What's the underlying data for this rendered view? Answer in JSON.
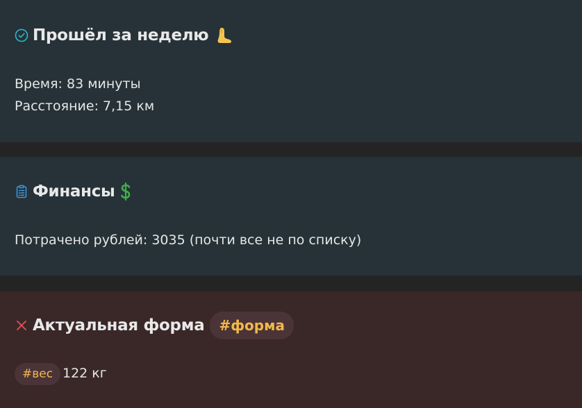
{
  "walk": {
    "title": "Прошёл за неделю",
    "icon": "check-circle-icon",
    "emoji": "foot-emoji",
    "time_line": "Время: 83 минуты",
    "distance_line": "Расстояние: 7,15 км"
  },
  "finance": {
    "title": "Финансы",
    "icon": "clipboard-list-icon",
    "emoji": "dollar-sign-emoji",
    "spent_line": "Потрачено рублей: 3035 (почти все не по списку)"
  },
  "form": {
    "title": "Актуальная форма",
    "icon": "cross-icon",
    "tag": "#форма",
    "weight_tag": "#вес",
    "weight_value": "122 кг"
  },
  "colors": {
    "blue_card": "#263238",
    "red_card": "#3a2728",
    "tag_text": "#f2b84b",
    "check_icon": "#2fb8c9",
    "clipboard_icon": "#3b9be0",
    "cross_icon": "#e2555a"
  }
}
